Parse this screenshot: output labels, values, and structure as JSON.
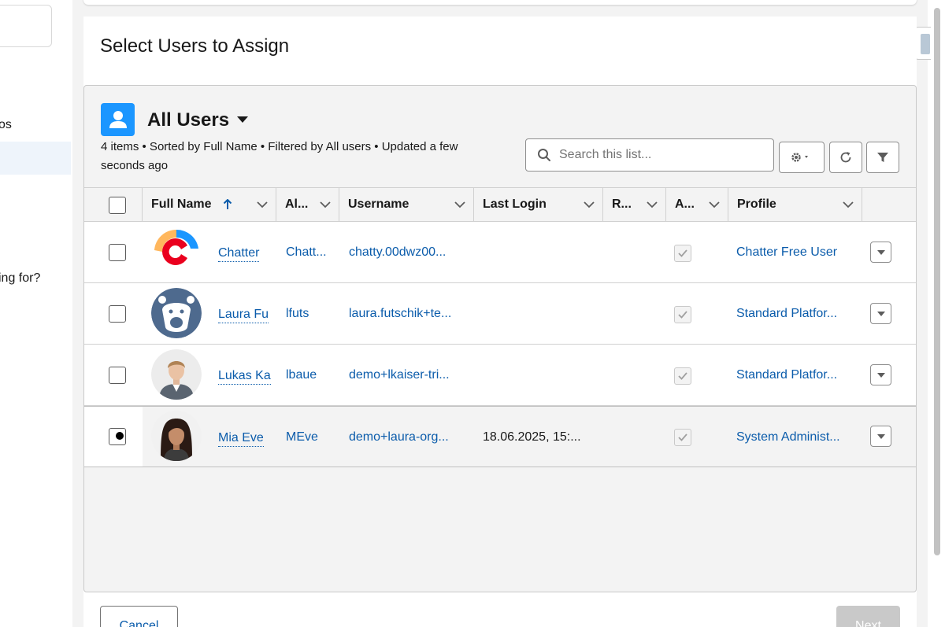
{
  "background": {
    "left_text_1": "os",
    "left_text_2": "ing for?"
  },
  "modal": {
    "title": "Select Users to Assign"
  },
  "list_view": {
    "icon": "user-icon",
    "title": "All Users",
    "meta": "4 items • Sorted by Full Name • Filtered by All users • Updated a few seconds ago",
    "search_placeholder": "Search this list..."
  },
  "table": {
    "columns": [
      {
        "label": "Full Name",
        "sorted": "ascending"
      },
      {
        "label": "Al..."
      },
      {
        "label": "Username"
      },
      {
        "label": "Last Login"
      },
      {
        "label": "R..."
      },
      {
        "label": "A..."
      },
      {
        "label": "Profile"
      }
    ],
    "rows": [
      {
        "full_name": "Chatter",
        "alias": "Chatt...",
        "username": "chatty.00dwz00...",
        "last_login": "",
        "active": true,
        "profile": "Chatter Free User",
        "selected": false
      },
      {
        "full_name": "Laura Fu",
        "alias": "lfuts",
        "username": "laura.futschik+te...",
        "last_login": "",
        "active": true,
        "profile": "Standard Platfor...",
        "selected": false
      },
      {
        "full_name": "Lukas Ka",
        "alias": "lbaue",
        "username": "demo+lkaiser-tri...",
        "last_login": "",
        "active": true,
        "profile": "Standard Platfor...",
        "selected": false
      },
      {
        "full_name": "Mia Eve",
        "alias": "MEve",
        "username": "demo+laura-org...",
        "last_login": "18.06.2025, 15:...",
        "active": true,
        "profile": "System Administ...",
        "selected": true
      }
    ]
  },
  "footer": {
    "cancel_label": "Cancel",
    "next_label": "Next"
  },
  "colors": {
    "brand_blue": "#1b96ff",
    "link_blue": "#0b5cab",
    "disabled_gray": "#c9c9c9"
  }
}
